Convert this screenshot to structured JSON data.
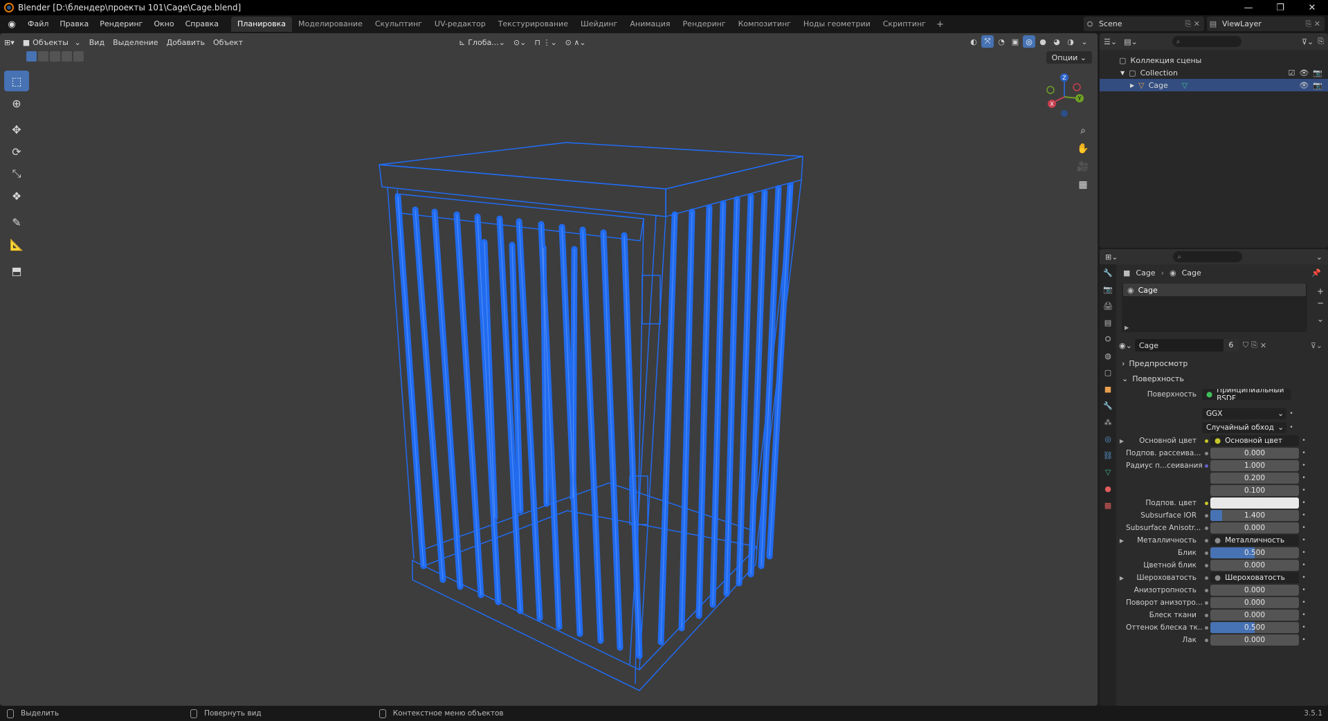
{
  "window": {
    "title": "Blender [D:\\блендер\\проекты 101\\Cage\\Cage.blend]",
    "controls": [
      "—",
      "❐",
      "✕"
    ]
  },
  "topbar": {
    "menus": [
      "Файл",
      "Правка",
      "Рендеринг",
      "Окно",
      "Справка"
    ],
    "workspaces": [
      {
        "label": "Планировка",
        "active": true
      },
      {
        "label": "Моделирование"
      },
      {
        "label": "Скульптинг"
      },
      {
        "label": "UV-редактор"
      },
      {
        "label": "Текстурирование"
      },
      {
        "label": "Шейдинг"
      },
      {
        "label": "Анимация"
      },
      {
        "label": "Рендеринг"
      },
      {
        "label": "Композитинг"
      },
      {
        "label": "Ноды геометрии"
      },
      {
        "label": "Скриптинг"
      }
    ],
    "add_workspace": "+",
    "scene": "Scene",
    "view_layer": "ViewLayer"
  },
  "viewport": {
    "mode": "Объекты",
    "menus": [
      "Вид",
      "Выделение",
      "Добавить",
      "Объект"
    ],
    "transform_orientation": "Глоба...",
    "options": "Опции",
    "gizmo_axes": [
      "X",
      "Y",
      "Z"
    ]
  },
  "outliner": {
    "rows": [
      {
        "label": "Коллекция сцены",
        "indent": 0
      },
      {
        "label": "Collection",
        "indent": 1
      },
      {
        "label": "Cage",
        "indent": 2,
        "selected": true
      }
    ]
  },
  "properties": {
    "breadcrumb": [
      "Cage",
      "Cage"
    ],
    "material_slot": "Cage",
    "material_name": "Cage",
    "user_count": "6",
    "sections": {
      "preview": "Предпросмотр",
      "surface": "Поверхность"
    },
    "surface_shader": {
      "label": "Поверхность",
      "value": "Принципиальный BSDF"
    },
    "distribution": "GGX",
    "subsurface_method": "Случайный обход",
    "rows": [
      {
        "label": "Основной цвет",
        "value": "Основной цвет",
        "kind": "link",
        "expand": true,
        "dot": "#c7c729"
      },
      {
        "label": "Подпов. рассеива...",
        "value": "0.000",
        "kind": "num",
        "dot": "#8a8a8a"
      },
      {
        "label": "Радиус п...сеивания",
        "value": "1.000",
        "kind": "num",
        "dot": "#6363c7"
      },
      {
        "label": "",
        "value": "0.200",
        "kind": "num",
        "dot": ""
      },
      {
        "label": "",
        "value": "0.100",
        "kind": "num",
        "dot": ""
      },
      {
        "label": "Подпов. цвет",
        "value": "",
        "kind": "color",
        "dot": "#c7c729"
      },
      {
        "label": "Subsurface IOR",
        "value": "1.400",
        "kind": "num",
        "fill": 0.13,
        "dot": "#8a8a8a"
      },
      {
        "label": "Subsurface Anisotr...",
        "value": "0.000",
        "kind": "num",
        "dot": "#8a8a8a"
      },
      {
        "label": "Металличность",
        "value": "Металличность",
        "kind": "link",
        "expand": true,
        "dot": "#8a8a8a"
      },
      {
        "label": "Блик",
        "value": "0.500",
        "kind": "num",
        "fill": 0.5,
        "dot": "#8a8a8a"
      },
      {
        "label": "Цветной блик",
        "value": "0.000",
        "kind": "num",
        "dot": "#8a8a8a"
      },
      {
        "label": "Шероховатость",
        "value": "Шероховатость",
        "kind": "link",
        "expand": true,
        "dot": "#8a8a8a"
      },
      {
        "label": "Анизотропность",
        "value": "0.000",
        "kind": "num",
        "dot": "#8a8a8a"
      },
      {
        "label": "Поворот анизотро...",
        "value": "0.000",
        "kind": "num",
        "dot": "#8a8a8a"
      },
      {
        "label": "Блеск ткани",
        "value": "0.000",
        "kind": "num",
        "dot": "#8a8a8a"
      },
      {
        "label": "Оттенок блеска тк...",
        "value": "0.500",
        "kind": "num",
        "fill": 0.5,
        "dot": "#8a8a8a"
      },
      {
        "label": "Лак",
        "value": "0.000",
        "kind": "num",
        "dot": "#8a8a8a"
      }
    ]
  },
  "statusbar": {
    "items": [
      "Выделить",
      "Повернуть вид",
      "Контекстное меню объектов"
    ],
    "version": "3.5.1"
  },
  "colors": {
    "accent": "#4772b3",
    "wireframe": "#1f6fff",
    "viewport_bg": "#3d3d3d"
  }
}
